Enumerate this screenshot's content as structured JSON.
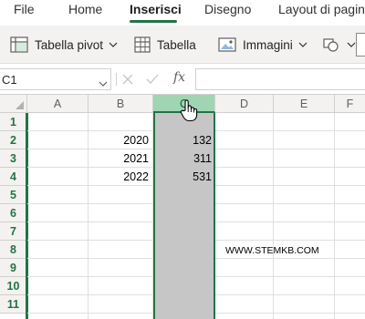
{
  "ribbon": {
    "tabs": [
      {
        "label": "File"
      },
      {
        "label": "Home"
      },
      {
        "label": "Inserisci",
        "active": true
      },
      {
        "label": "Disegno"
      },
      {
        "label": "Layout di pagina"
      }
    ]
  },
  "toolbar": {
    "pivot_label": "Tabella pivot",
    "table_label": "Tabella",
    "images_label": "Immagini",
    "pivot_icon": "pivot-table-icon",
    "table_icon": "table-icon",
    "images_icon": "image-icon",
    "shapes_icon": "shapes-icon"
  },
  "formula_bar": {
    "name_box": "C1",
    "fx": "fx",
    "value": ""
  },
  "grid": {
    "columns": [
      "A",
      "B",
      "C",
      "D",
      "E",
      "F"
    ],
    "selected_column": "C",
    "rows": [
      "1",
      "2",
      "3",
      "4",
      "5",
      "6",
      "7",
      "8",
      "9",
      "10",
      "11"
    ],
    "data": [
      {
        "row": 2,
        "B": "2020",
        "C": "132"
      },
      {
        "row": 3,
        "B": "2021",
        "C": "311"
      },
      {
        "row": 4,
        "B": "2022",
        "C": "531"
      }
    ],
    "watermark": "WWW.STEMKB.COM"
  },
  "colors": {
    "accent": "#217346",
    "selected_header": "#9fd5b3",
    "selected_fill": "#c6c6c6"
  }
}
